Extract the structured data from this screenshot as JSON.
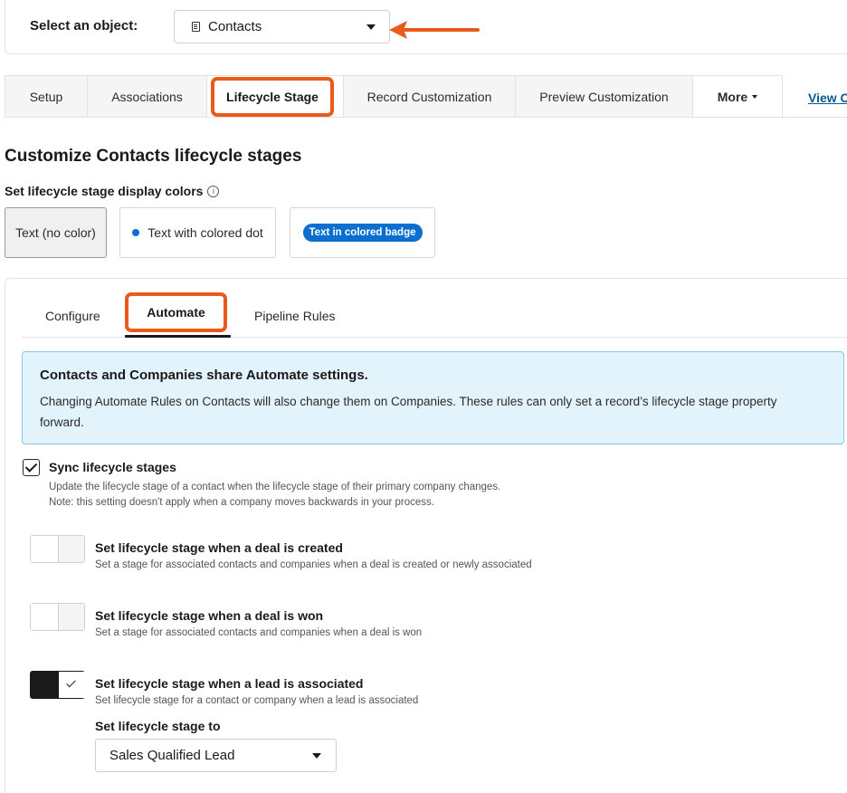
{
  "object_selector": {
    "label": "Select an object:",
    "value": "Contacts",
    "icon": "document-icon"
  },
  "tabs": [
    {
      "label": "Setup"
    },
    {
      "label": "Associations"
    },
    {
      "label": "Lifecycle Stage",
      "active": true
    },
    {
      "label": "Record Customization"
    },
    {
      "label": "Preview Customization"
    },
    {
      "label": "More"
    }
  ],
  "view_link": "View C",
  "page_title": "Customize Contacts lifecycle stages",
  "display_colors": {
    "label": "Set lifecycle stage display colors",
    "options": [
      {
        "label": "Text (no color)",
        "selected": true
      },
      {
        "label": "Text with colored dot"
      },
      {
        "label": "Text in colored badge"
      }
    ]
  },
  "sub_tabs": [
    {
      "label": "Configure"
    },
    {
      "label": "Automate",
      "active": true
    },
    {
      "label": "Pipeline Rules"
    }
  ],
  "alert": {
    "title": "Contacts and Companies share Automate settings.",
    "body": "Changing Automate Rules on Contacts will also change them on Companies. These rules can only set a record’s lifecycle stage property forward."
  },
  "sync": {
    "checked": true,
    "title": "Sync lifecycle stages",
    "desc_line1": "Update the lifecycle stage of a contact when the lifecycle stage of their primary company changes.",
    "desc_line2": "Note: this setting doesn't apply when a company moves backwards in your process."
  },
  "automations": [
    {
      "title": "Set lifecycle stage when a deal is created",
      "desc": "Set a stage for associated contacts and companies when a deal is created or newly associated",
      "enabled": false
    },
    {
      "title": "Set lifecycle stage when a deal is won",
      "desc": "Set a stage for associated contacts and companies when a deal is won",
      "enabled": false
    },
    {
      "title": "Set lifecycle stage when a lead is associated",
      "desc": "Set lifecycle stage for a contact or company when a lead is associated",
      "enabled": true
    }
  ],
  "stage_to": {
    "label": "Set lifecycle stage to",
    "value": "Sales Qualified Lead"
  },
  "colors": {
    "highlight": "#ea5a1a",
    "accent": "#0a6fcf",
    "alert_bg": "#e3f3fb",
    "link": "#0b5b8f"
  }
}
